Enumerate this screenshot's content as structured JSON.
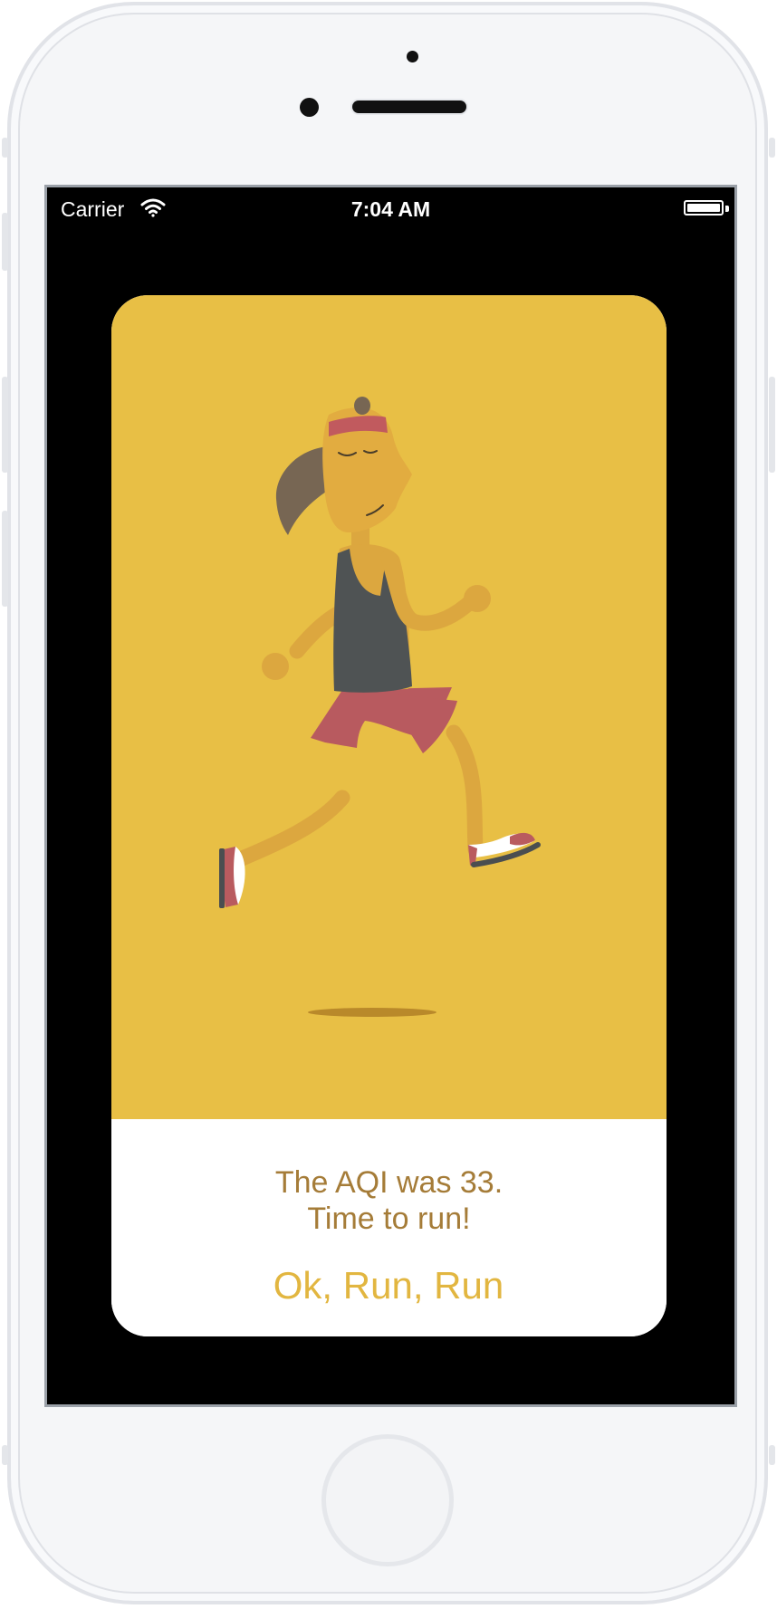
{
  "status_bar": {
    "carrier": "Carrier",
    "time": "7:04 AM",
    "wifi_icon": "wifi-icon",
    "battery_icon": "battery-icon"
  },
  "card": {
    "illustration": "runner-illustration",
    "message_line1": "The AQI was 33.",
    "message_line2": "Time to run!",
    "button_label": "Ok, Run, Run"
  },
  "colors": {
    "illustration_bg": "#e8bf45",
    "message_text": "#a57c38",
    "button_text": "#e2b640",
    "screen_bg": "#000000"
  }
}
